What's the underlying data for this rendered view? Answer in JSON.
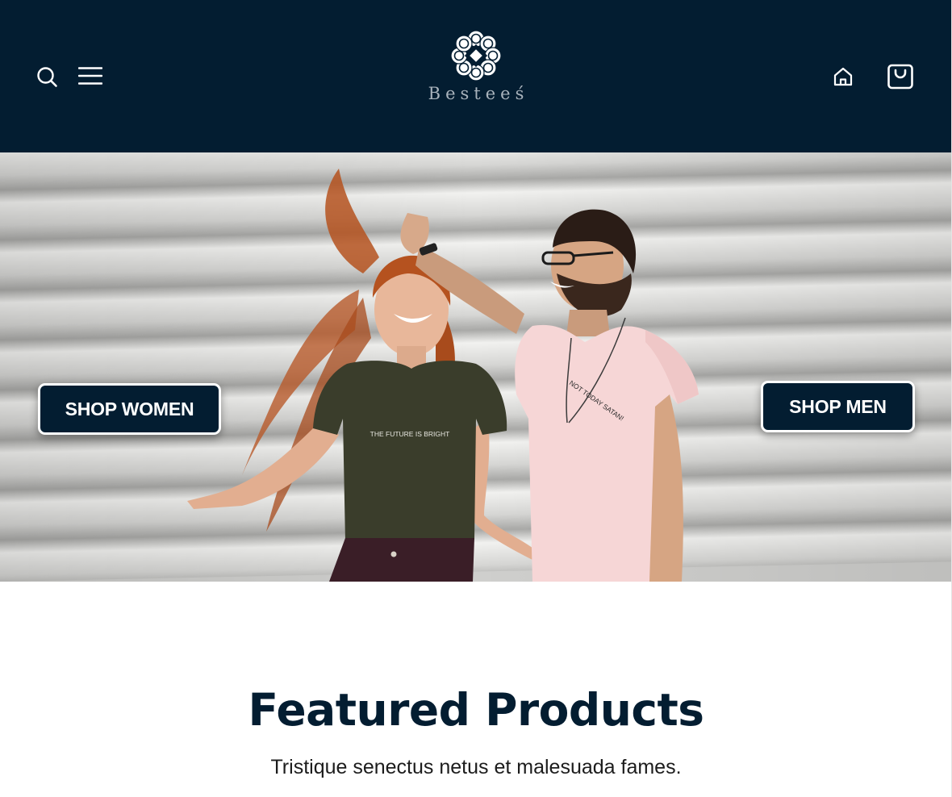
{
  "header": {
    "brand_name": "Besteeś",
    "icons": {
      "search": "search-icon",
      "menu": "hamburger-menu-icon",
      "home": "home-icon",
      "cart": "shopping-bag-icon"
    }
  },
  "hero": {
    "shop_women_label": "SHOP WOMEN",
    "shop_men_label": "SHOP MEN",
    "shirt_text_women": "THE FUTURE IS BRIGHT",
    "shirt_text_men": "NOT TODAY SATAN!"
  },
  "featured": {
    "title": "Featured Products",
    "subtitle": "Tristique senectus netus et malesuada fames."
  },
  "colors": {
    "header_bg": "#031d31",
    "button_bg": "#031d31",
    "title_color": "#031d31"
  }
}
